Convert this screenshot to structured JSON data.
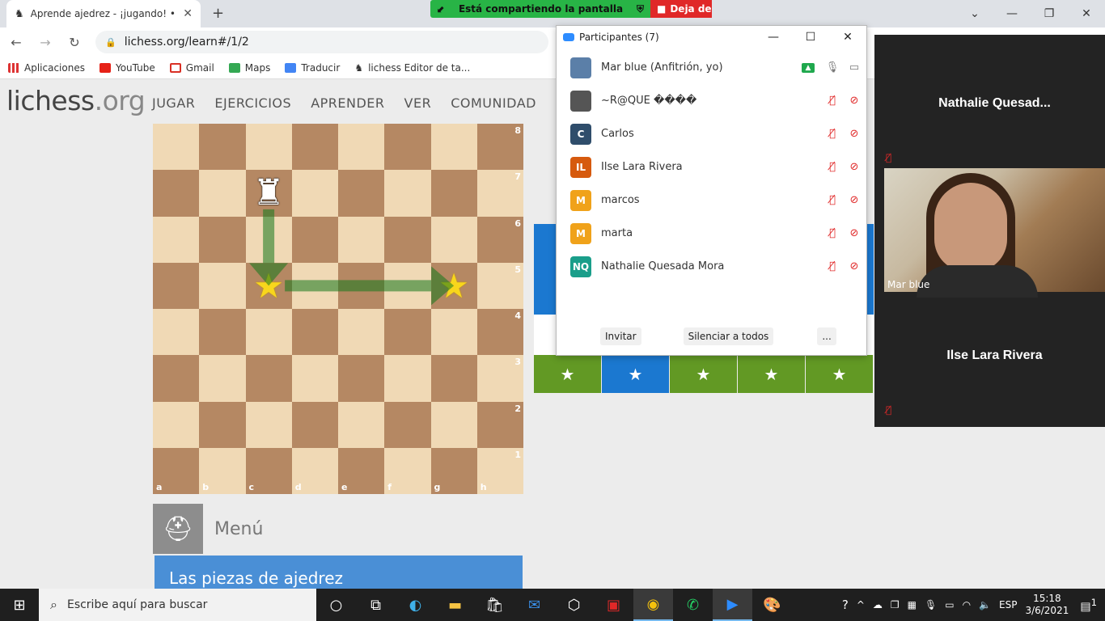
{
  "browser": {
    "tab_title": "Aprende ajedrez - ¡jugando! • lic",
    "url": "lichess.org/learn#/1/2",
    "bookmarks": [
      "Aplicaciones",
      "YouTube",
      "Gmail",
      "Maps",
      "Traducir",
      "lichess Editor de ta..."
    ]
  },
  "share_banner": {
    "sharing": "Está compartiendo la pantalla",
    "stop": "Deja de"
  },
  "site": {
    "logo_main": "lichess",
    "logo_tld": ".org",
    "nav": [
      "JUGAR",
      "EJERCICIOS",
      "APRENDER",
      "VER",
      "COMUNIDAD"
    ],
    "menu_label": "Menú",
    "section_title": "Las piezas de ajedrez"
  },
  "board": {
    "ranks": [
      "8",
      "7",
      "6",
      "5",
      "4",
      "3",
      "2",
      "1"
    ],
    "files": [
      "a",
      "b",
      "c",
      "d",
      "e",
      "f",
      "g",
      "h"
    ],
    "pieces": [
      {
        "square": "c7",
        "piece": "white-rook",
        "glyph": "♜"
      }
    ],
    "stars": [
      "c5",
      "g5"
    ],
    "arrows": [
      {
        "from": "c7",
        "to": "c5"
      },
      {
        "from": "c5",
        "to": "g5"
      }
    ],
    "light": "#f0d9b5",
    "dark": "#b58863"
  },
  "lesson_stars": {
    "count": 5,
    "active_index": 1,
    "glyph": "★"
  },
  "zoom": {
    "title": "Participantes (7)",
    "participants": [
      {
        "name": "Mar blue (Anfitrión, yo)",
        "initials": "",
        "color": "#5b7fa8",
        "muted": false,
        "video_off": false,
        "sharing": true
      },
      {
        "name": "~R@QUE ����",
        "initials": "",
        "color": "#555555",
        "muted": true,
        "video_off": true,
        "sharing": false
      },
      {
        "name": "Carlos",
        "initials": "C",
        "color": "#2f4d6b",
        "muted": true,
        "video_off": true,
        "sharing": false
      },
      {
        "name": "Ilse Lara Rivera",
        "initials": "IL",
        "color": "#d65a0e",
        "muted": true,
        "video_off": true,
        "sharing": false
      },
      {
        "name": "marcos",
        "initials": "M",
        "color": "#f0a21a",
        "muted": true,
        "video_off": true,
        "sharing": false
      },
      {
        "name": "marta",
        "initials": "M",
        "color": "#f0a21a",
        "muted": true,
        "video_off": true,
        "sharing": false
      },
      {
        "name": "Nathalie Quesada Mora",
        "initials": "NQ",
        "color": "#1a9e8a",
        "muted": true,
        "video_off": true,
        "sharing": false
      }
    ],
    "invite": "Invitar",
    "mute_all": "Silenciar a todos",
    "more": "...",
    "video_tiles": {
      "top": "Nathalie  Quesad...",
      "cam_label": "Mar blue",
      "bottom": "Ilse Lara Rivera"
    }
  },
  "taskbar": {
    "search_placeholder": "Escribe aquí para buscar",
    "language": "ESP",
    "time": "15:18",
    "date": "3/6/2021",
    "notifications": "1"
  }
}
